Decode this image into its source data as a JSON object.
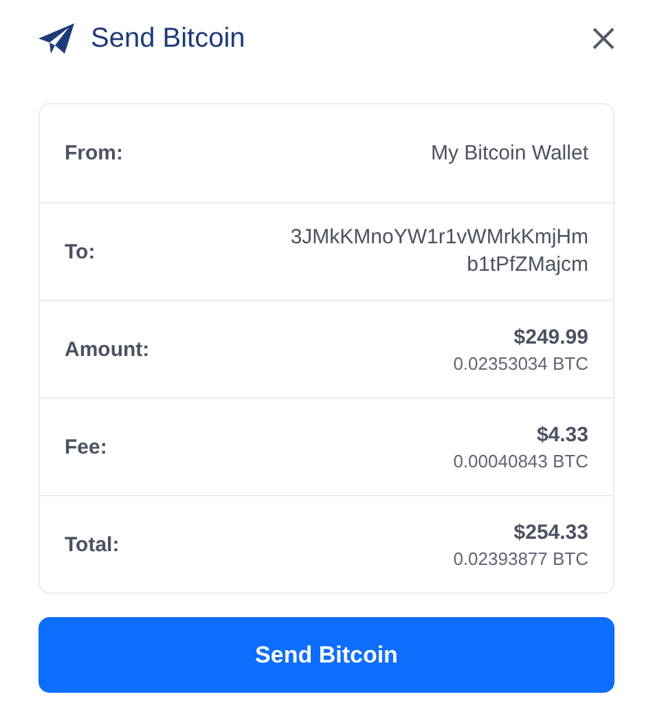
{
  "header": {
    "title": "Send Bitcoin"
  },
  "details": [
    {
      "kind": "text",
      "label": "From:",
      "value": "My Bitcoin Wallet"
    },
    {
      "kind": "address",
      "label": "To:",
      "value": "3JMkKMnoYW1r1vWMrkKmjHmb1tPfZMajcm"
    },
    {
      "kind": "amount",
      "label": "Amount:",
      "fiat": "$249.99",
      "crypto": "0.02353034 BTC"
    },
    {
      "kind": "amount",
      "label": "Fee:",
      "fiat": "$4.33",
      "crypto": "0.00040843 BTC"
    },
    {
      "kind": "amount",
      "label": "Total:",
      "fiat": "$254.33",
      "crypto": "0.02393877 BTC"
    }
  ],
  "button": {
    "label": "Send Bitcoin"
  }
}
